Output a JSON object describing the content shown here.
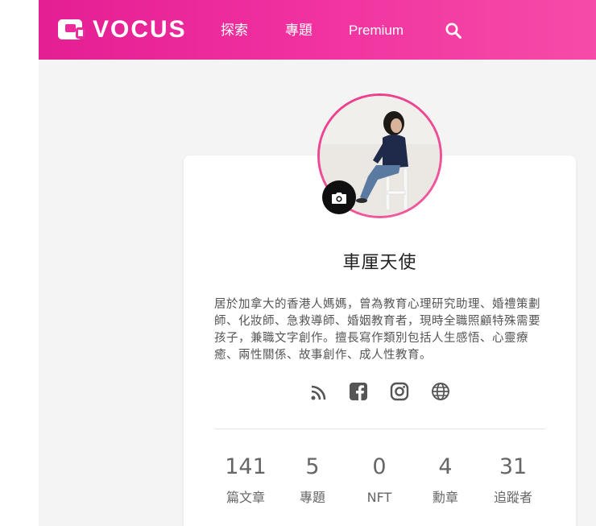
{
  "brand": {
    "logo_text": "VOCUS",
    "color": "#eb2a9b"
  },
  "nav": [
    {
      "label": "探索"
    },
    {
      "label": "專題"
    },
    {
      "label": "Premium"
    }
  ],
  "nav_search_icon": "search-icon",
  "profile": {
    "name": "車厘天使",
    "bio": "居於加拿大的香港人媽媽，曾為教育心理研究助理、婚禮策劃師、化妝師、急救導師、婚姻教育者，現時全職照顧特殊需要孩子，兼職文字創作。擅長寫作類別包括人生感悟、心靈療癒、兩性關係、故事創作、成人性教育。",
    "camera_icon": "camera-icon"
  },
  "social_links": [
    {
      "icon": "rss-icon"
    },
    {
      "icon": "facebook-icon"
    },
    {
      "icon": "instagram-icon"
    },
    {
      "icon": "globe-icon"
    }
  ],
  "stats": [
    {
      "value": "141",
      "label": "篇文章"
    },
    {
      "value": "5",
      "label": "專題"
    },
    {
      "value": "0",
      "label": "NFT"
    },
    {
      "value": "4",
      "label": "勳章"
    },
    {
      "value": "31",
      "label": "追蹤者"
    }
  ]
}
